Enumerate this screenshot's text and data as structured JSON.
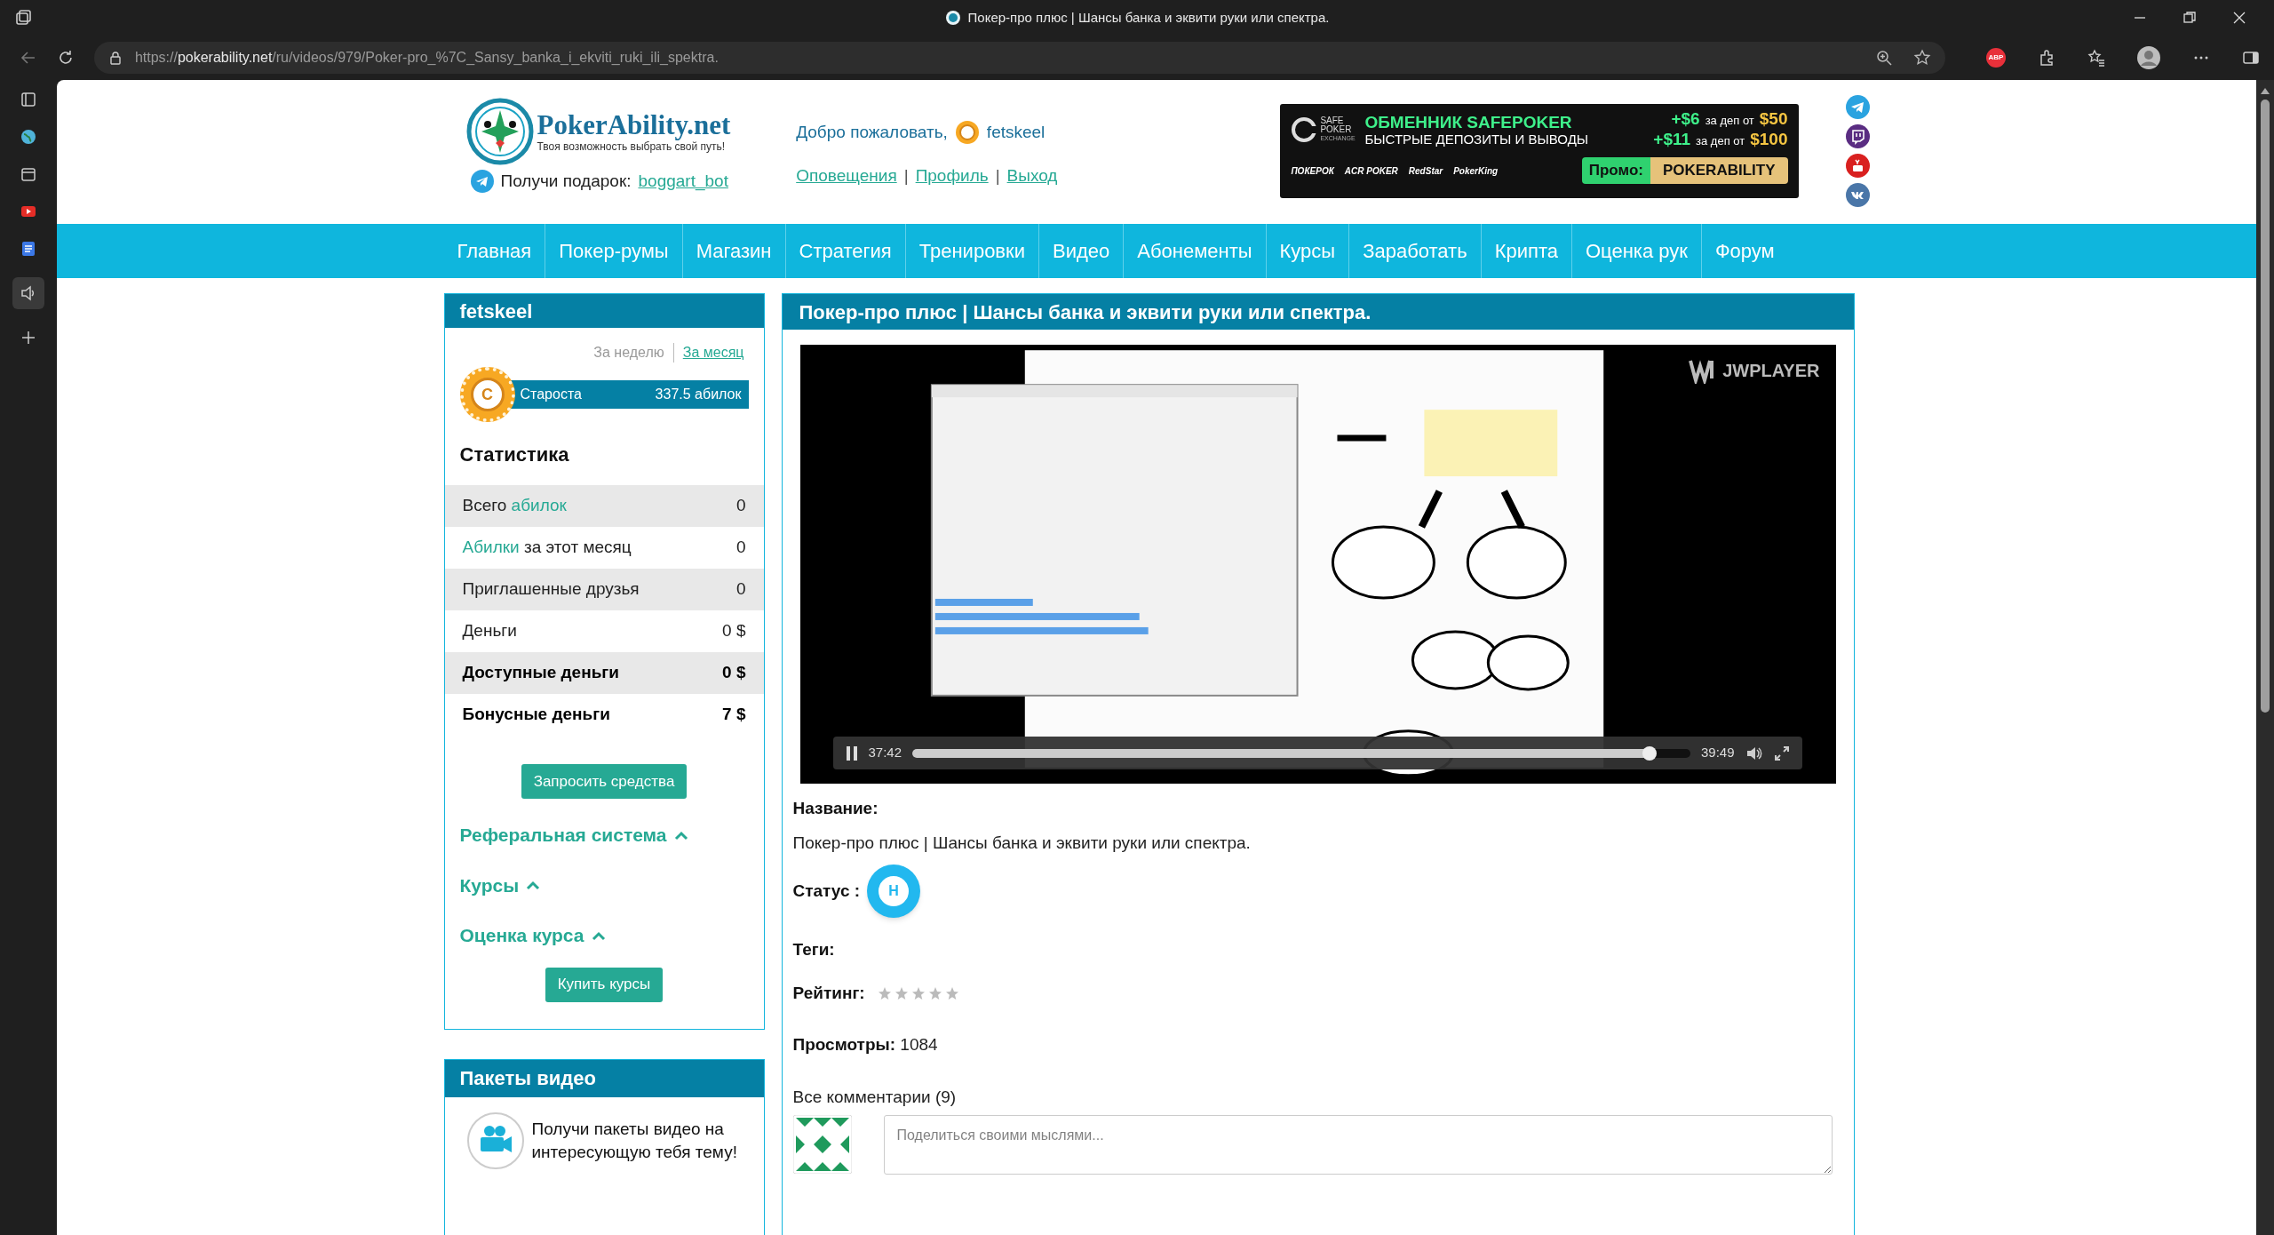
{
  "browser": {
    "tab_title": "Покер-про плюс | Шансы банка и эквити руки или спектра.",
    "url_scheme": "https://",
    "url_host": "pokerability.net",
    "url_path": "/ru/videos/979/Poker-pro_%7C_Sansy_banka_i_ekviti_ruki_ili_spektra.",
    "extension_badge": "ABP"
  },
  "header": {
    "logo_title": "PokerAbility.net",
    "logo_tagline": "Твоя возможность выбрать свой путь!",
    "gift_label": "Получи подарок:",
    "gift_link": "boggart_bot",
    "welcome": "Добро пожаловать,",
    "username": "fetskeel",
    "user_links": [
      "Оповещения",
      "Профиль",
      "Выход"
    ],
    "separators": [
      "|",
      "|"
    ]
  },
  "banner": {
    "brand": "SAFE POKER",
    "brand_sub": "EXCHANGE",
    "headline": "ОБМЕННИК SAFEPOKER",
    "subline": "БЫСТРЫЕ ДЕПОЗИТЫ И ВЫВОДЫ",
    "offers": [
      {
        "bonus": "+$6",
        "text": "за деп от",
        "amount": "$50"
      },
      {
        "bonus": "+$11",
        "text": "за деп от",
        "amount": "$100"
      }
    ],
    "partners": [
      "ПОКЕРОК",
      "ACR POKER",
      "RedStar",
      "PokerKing"
    ],
    "promo_label": "Промо:",
    "promo_code": "POKERABILITY"
  },
  "nav": [
    "Главная",
    "Покер-румы",
    "Магазин",
    "Стратегия",
    "Тренировки",
    "Видео",
    "Абонементы",
    "Курсы",
    "Заработать",
    "Крипта",
    "Оценка рук",
    "Форум"
  ],
  "sidebar": {
    "title": "fetskeel",
    "periods": [
      {
        "label": "За неделю",
        "selected": true
      },
      {
        "label": "За месяц",
        "selected": false
      }
    ],
    "rank_badge": "С",
    "rank_name": "Староста",
    "rank_points": "337.5 абилок",
    "stats_title": "Статистика",
    "stats": [
      {
        "parts": [
          {
            "text": "Всего ",
            "link": false
          },
          {
            "text": "абилок",
            "link": true
          }
        ],
        "value": "0",
        "bold": false
      },
      {
        "parts": [
          {
            "text": "Абилки",
            "link": true
          },
          {
            "text": " за этот месяц",
            "link": false
          }
        ],
        "value": "0",
        "bold": false
      },
      {
        "parts": [
          {
            "text": "Приглашенные друзья",
            "link": false
          }
        ],
        "value": "0",
        "bold": false
      },
      {
        "parts": [
          {
            "text": "Деньги",
            "link": false
          }
        ],
        "value": "0 $",
        "bold": false
      },
      {
        "parts": [
          {
            "text": "Доступные деньги",
            "link": false
          }
        ],
        "value": "0 $",
        "bold": true
      },
      {
        "parts": [
          {
            "text": "Бонусные деньги",
            "link": false
          }
        ],
        "value": "7 $",
        "bold": true
      }
    ],
    "request_button": "Запросить средства",
    "sections": [
      "Реферальная система",
      "Курсы",
      "Оценка курса"
    ],
    "buy_button": "Купить курсы",
    "packs_title": "Пакеты видео",
    "packs_text": "Получи пакеты видео на интересующую тебя тему!"
  },
  "video": {
    "title": "Покер-про плюс | Шансы банка и эквити руки или спектра.",
    "player_logo": "JWPLAYER",
    "elapsed": "37:42",
    "duration": "39:49",
    "progress": {
      "level": 0.947
    },
    "playing": true
  },
  "details": {
    "name_label": "Название:",
    "name": "Покер-про плюс | Шансы банка и эквити руки или спектра.",
    "status_label": "Статус :",
    "status_badge": "Н",
    "tags_label": "Теги:",
    "rating_label": "Рейтинг:",
    "rating": {
      "stars": 0
    },
    "views_label": "Просмотры:",
    "views": "1084",
    "comments_title": "Все комментарии (9)",
    "comment_placeholder": "Поделиться своими мыслями..."
  }
}
